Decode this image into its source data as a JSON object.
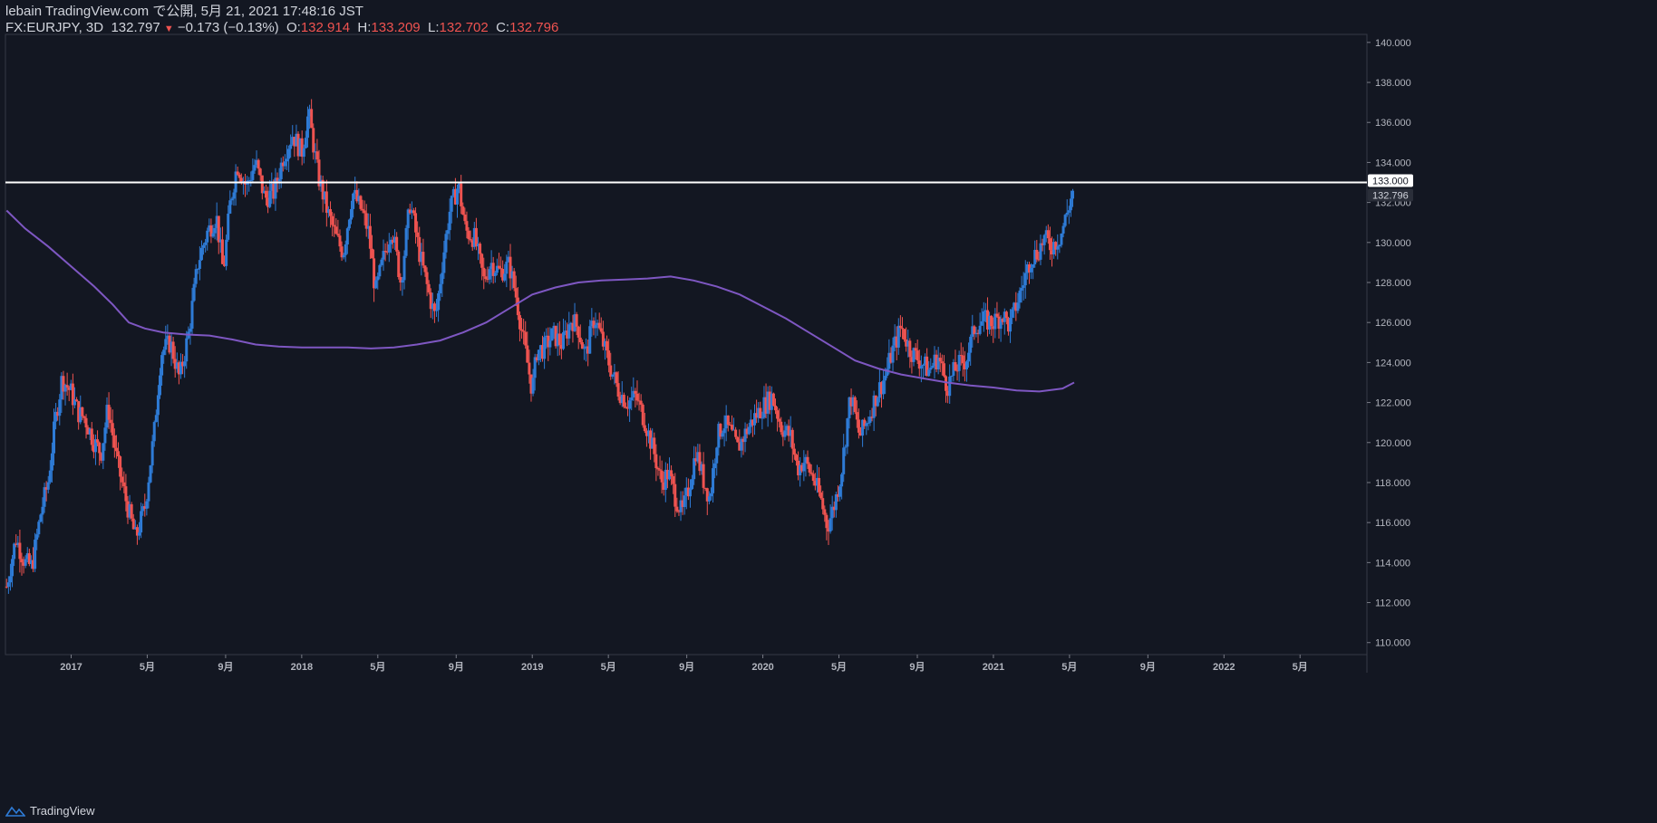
{
  "header": {
    "line1": "lebain TradingView.com で公開, 5月 21, 2021 17:48:16 JST",
    "symbol": "FX:EURJPY, 3D",
    "last": "132.797",
    "change": "−0.173 (−0.13%)",
    "o_label": "O:",
    "o_val": "132.914",
    "h_label": "H:",
    "h_val": "133.209",
    "l_label": "L:",
    "l_val": "132.702",
    "c_label": "C:",
    "c_val": "132.796"
  },
  "footer": {
    "brand": "TradingView"
  },
  "colors": {
    "background": "#131722",
    "up": "#2e7bd6",
    "down": "#ef5350",
    "ma": "#7e57c2",
    "hline": "#ffffff",
    "text": "#d1d4dc"
  },
  "chart_data": {
    "type": "candlestick",
    "symbol": "FX:EURJPY",
    "interval": "3D",
    "ylim": [
      109.4,
      140.4
    ],
    "y_ticks": [
      "110.000",
      "112.000",
      "114.000",
      "116.000",
      "118.000",
      "120.000",
      "122.000",
      "124.000",
      "126.000",
      "128.000",
      "130.000",
      "132.000",
      "134.000",
      "136.000",
      "138.000",
      "140.000"
    ],
    "x_ticks": [
      {
        "label": "2017",
        "t": 2017.0
      },
      {
        "label": "5月",
        "t": 2017.33
      },
      {
        "label": "9月",
        "t": 2017.67
      },
      {
        "label": "2018",
        "t": 2018.0
      },
      {
        "label": "5月",
        "t": 2018.33
      },
      {
        "label": "9月",
        "t": 2018.67
      },
      {
        "label": "2019",
        "t": 2019.0
      },
      {
        "label": "5月",
        "t": 2019.33
      },
      {
        "label": "9月",
        "t": 2019.67
      },
      {
        "label": "2020",
        "t": 2020.0
      },
      {
        "label": "5月",
        "t": 2020.33
      },
      {
        "label": "9月",
        "t": 2020.67
      },
      {
        "label": "2021",
        "t": 2021.0
      },
      {
        "label": "5月",
        "t": 2021.33
      },
      {
        "label": "9月",
        "t": 2021.67
      },
      {
        "label": "2022",
        "t": 2022.0
      },
      {
        "label": "5月",
        "t": 2022.33
      }
    ],
    "horizontal_line": {
      "value": 133.0,
      "label": "133.000"
    },
    "last_price_label": "132.796",
    "close_path": [
      [
        2016.72,
        112.8
      ],
      [
        2016.76,
        115.2
      ],
      [
        2016.8,
        114.0
      ],
      [
        2016.83,
        113.8
      ],
      [
        2016.87,
        116.6
      ],
      [
        2016.9,
        118.0
      ],
      [
        2016.93,
        121.0
      ],
      [
        2016.96,
        123.2
      ],
      [
        2017.0,
        122.5
      ],
      [
        2017.03,
        121.5
      ],
      [
        2017.06,
        121.2
      ],
      [
        2017.1,
        120.0
      ],
      [
        2017.13,
        119.5
      ],
      [
        2017.16,
        121.8
      ],
      [
        2017.2,
        119.0
      ],
      [
        2017.24,
        117.0
      ],
      [
        2017.28,
        115.2
      ],
      [
        2017.32,
        116.8
      ],
      [
        2017.36,
        120.5
      ],
      [
        2017.39,
        124.5
      ],
      [
        2017.43,
        125.0
      ],
      [
        2017.47,
        123.2
      ],
      [
        2017.51,
        125.5
      ],
      [
        2017.55,
        129.0
      ],
      [
        2017.59,
        130.5
      ],
      [
        2017.63,
        131.3
      ],
      [
        2017.66,
        128.5
      ],
      [
        2017.69,
        132.0
      ],
      [
        2017.72,
        133.9
      ],
      [
        2017.76,
        132.8
      ],
      [
        2017.8,
        134.0
      ],
      [
        2017.84,
        132.2
      ],
      [
        2017.88,
        132.5
      ],
      [
        2017.92,
        134.3
      ],
      [
        2017.96,
        135.4
      ],
      [
        2018.0,
        134.5
      ],
      [
        2018.03,
        136.5
      ],
      [
        2018.07,
        133.4
      ],
      [
        2018.11,
        131.6
      ],
      [
        2018.15,
        130.2
      ],
      [
        2018.18,
        129.5
      ],
      [
        2018.22,
        132.5
      ],
      [
        2018.26,
        131.6
      ],
      [
        2018.29,
        130.5
      ],
      [
        2018.32,
        127.5
      ],
      [
        2018.35,
        129.0
      ],
      [
        2018.39,
        130.8
      ],
      [
        2018.43,
        128.0
      ],
      [
        2018.47,
        132.0
      ],
      [
        2018.51,
        129.5
      ],
      [
        2018.55,
        127.5
      ],
      [
        2018.58,
        126.2
      ],
      [
        2018.61,
        129.0
      ],
      [
        2018.64,
        131.5
      ],
      [
        2018.68,
        132.9
      ],
      [
        2018.71,
        130.6
      ],
      [
        2018.75,
        130.2
      ],
      [
        2018.79,
        128.1
      ],
      [
        2018.82,
        129.0
      ],
      [
        2018.86,
        128.5
      ],
      [
        2018.9,
        128.9
      ],
      [
        2018.93,
        127.3
      ],
      [
        2018.96,
        125.2
      ],
      [
        2019.0,
        122.6
      ],
      [
        2019.02,
        124.6
      ],
      [
        2019.05,
        124.7
      ],
      [
        2019.09,
        125.4
      ],
      [
        2019.13,
        124.9
      ],
      [
        2019.17,
        126.2
      ],
      [
        2019.2,
        125.7
      ],
      [
        2019.23,
        124.3
      ],
      [
        2019.27,
        126.3
      ],
      [
        2019.3,
        125.2
      ],
      [
        2019.34,
        123.7
      ],
      [
        2019.37,
        122.7
      ],
      [
        2019.41,
        122.0
      ],
      [
        2019.45,
        122.3
      ],
      [
        2019.49,
        121.0
      ],
      [
        2019.53,
        119.4
      ],
      [
        2019.56,
        118.0
      ],
      [
        2019.59,
        118.5
      ],
      [
        2019.62,
        117.3
      ],
      [
        2019.65,
        116.4
      ],
      [
        2019.68,
        117.8
      ],
      [
        2019.71,
        119.6
      ],
      [
        2019.74,
        118.2
      ],
      [
        2019.77,
        117.2
      ],
      [
        2019.8,
        120.2
      ],
      [
        2019.83,
        121.0
      ],
      [
        2019.86,
        120.5
      ],
      [
        2019.89,
        119.7
      ],
      [
        2019.92,
        120.4
      ],
      [
        2019.96,
        121.2
      ],
      [
        2020.0,
        121.8
      ],
      [
        2020.04,
        122.3
      ],
      [
        2020.08,
        120.8
      ],
      [
        2020.12,
        120.3
      ],
      [
        2020.15,
        118.7
      ],
      [
        2020.18,
        119.1
      ],
      [
        2020.22,
        118.2
      ],
      [
        2020.25,
        117.2
      ],
      [
        2020.28,
        115.8
      ],
      [
        2020.31,
        116.9
      ],
      [
        2020.34,
        118.5
      ],
      [
        2020.38,
        122.4
      ],
      [
        2020.42,
        120.3
      ],
      [
        2020.45,
        121.0
      ],
      [
        2020.49,
        122.3
      ],
      [
        2020.53,
        123.3
      ],
      [
        2020.56,
        124.5
      ],
      [
        2020.6,
        125.8
      ],
      [
        2020.64,
        124.6
      ],
      [
        2020.68,
        124.1
      ],
      [
        2020.72,
        123.6
      ],
      [
        2020.76,
        124.3
      ],
      [
        2020.8,
        122.8
      ],
      [
        2020.84,
        123.8
      ],
      [
        2020.88,
        124.1
      ],
      [
        2020.92,
        125.8
      ],
      [
        2020.96,
        126.1
      ],
      [
        2021.0,
        126.0
      ],
      [
        2021.04,
        126.4
      ],
      [
        2021.07,
        125.8
      ],
      [
        2021.1,
        126.9
      ],
      [
        2021.13,
        128.0
      ],
      [
        2021.16,
        129.2
      ],
      [
        2021.19,
        129.5
      ],
      [
        2021.22,
        130.2
      ],
      [
        2021.25,
        129.8
      ],
      [
        2021.29,
        130.3
      ],
      [
        2021.32,
        131.5
      ],
      [
        2021.35,
        132.796
      ]
    ],
    "series": [
      {
        "name": "",
        "type": "moving_average",
        "points": [
          [
            2016.72,
            131.6
          ],
          [
            2016.8,
            130.7
          ],
          [
            2016.9,
            129.8
          ],
          [
            2017.0,
            128.8
          ],
          [
            2017.1,
            127.8
          ],
          [
            2017.18,
            126.9
          ],
          [
            2017.25,
            126.0
          ],
          [
            2017.32,
            125.7
          ],
          [
            2017.4,
            125.5
          ],
          [
            2017.5,
            125.4
          ],
          [
            2017.6,
            125.35
          ],
          [
            2017.7,
            125.15
          ],
          [
            2017.8,
            124.9
          ],
          [
            2017.9,
            124.8
          ],
          [
            2018.0,
            124.75
          ],
          [
            2018.1,
            124.75
          ],
          [
            2018.2,
            124.75
          ],
          [
            2018.3,
            124.7
          ],
          [
            2018.4,
            124.75
          ],
          [
            2018.5,
            124.9
          ],
          [
            2018.6,
            125.1
          ],
          [
            2018.7,
            125.5
          ],
          [
            2018.8,
            126.0
          ],
          [
            2018.9,
            126.7
          ],
          [
            2019.0,
            127.4
          ],
          [
            2019.1,
            127.75
          ],
          [
            2019.2,
            128.0
          ],
          [
            2019.3,
            128.1
          ],
          [
            2019.4,
            128.15
          ],
          [
            2019.5,
            128.2
          ],
          [
            2019.6,
            128.3
          ],
          [
            2019.7,
            128.1
          ],
          [
            2019.8,
            127.8
          ],
          [
            2019.9,
            127.4
          ],
          [
            2020.0,
            126.8
          ],
          [
            2020.1,
            126.2
          ],
          [
            2020.2,
            125.5
          ],
          [
            2020.3,
            124.8
          ],
          [
            2020.4,
            124.1
          ],
          [
            2020.5,
            123.7
          ],
          [
            2020.6,
            123.4
          ],
          [
            2020.7,
            123.2
          ],
          [
            2020.8,
            123.0
          ],
          [
            2020.9,
            122.85
          ],
          [
            2021.0,
            122.75
          ],
          [
            2021.1,
            122.6
          ],
          [
            2021.2,
            122.55
          ],
          [
            2021.3,
            122.7
          ],
          [
            2021.35,
            123.0
          ]
        ]
      }
    ]
  }
}
